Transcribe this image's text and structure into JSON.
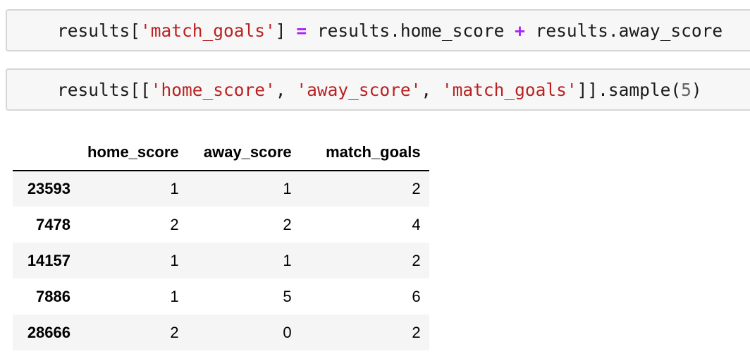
{
  "cells": [
    {
      "tokens": [
        {
          "text": "results[",
          "kind": "plain"
        },
        {
          "text": "'match_goals'",
          "kind": "str"
        },
        {
          "text": "] ",
          "kind": "plain"
        },
        {
          "text": "=",
          "kind": "op"
        },
        {
          "text": " results.home_score ",
          "kind": "plain"
        },
        {
          "text": "+",
          "kind": "op"
        },
        {
          "text": " results.away_score",
          "kind": "plain"
        }
      ]
    },
    {
      "tokens": [
        {
          "text": "results[[",
          "kind": "plain"
        },
        {
          "text": "'home_score'",
          "kind": "str"
        },
        {
          "text": ", ",
          "kind": "plain"
        },
        {
          "text": "'away_score'",
          "kind": "str"
        },
        {
          "text": ", ",
          "kind": "plain"
        },
        {
          "text": "'match_goals'",
          "kind": "str"
        },
        {
          "text": "]].sample(",
          "kind": "plain"
        },
        {
          "text": "5",
          "kind": "num"
        },
        {
          "text": ")",
          "kind": "plain"
        }
      ]
    }
  ],
  "table": {
    "columns": [
      "",
      "home_score",
      "away_score",
      "match_goals"
    ],
    "rows": [
      {
        "index": "23593",
        "values": [
          "1",
          "1",
          "2"
        ]
      },
      {
        "index": "7478",
        "values": [
          "2",
          "2",
          "4"
        ]
      },
      {
        "index": "14157",
        "values": [
          "1",
          "1",
          "2"
        ]
      },
      {
        "index": "7886",
        "values": [
          "1",
          "5",
          "6"
        ]
      },
      {
        "index": "28666",
        "values": [
          "2",
          "0",
          "2"
        ]
      }
    ]
  },
  "colors": {
    "string": "#ba2121",
    "operator": "#aa22ff",
    "number": "#666666",
    "cell_background": "#f7f7f7",
    "cell_border": "#d6d6d6"
  }
}
